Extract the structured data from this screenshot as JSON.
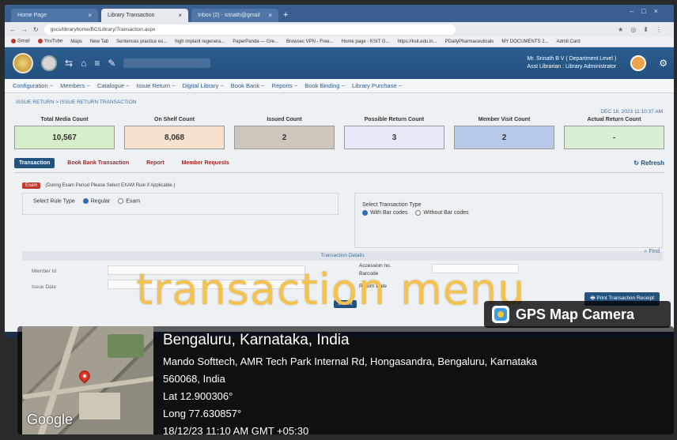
{
  "browser": {
    "tabs": [
      {
        "label": "Home Page",
        "active": false
      },
      {
        "label": "Library Transaction",
        "active": true
      },
      {
        "label": "Inbox (2) - srinath@gmail",
        "active": false
      }
    ],
    "url": "gscs/libraryhome/BC/Library/Transaction.aspx",
    "bookmarks": [
      "Gmail",
      "YouTube",
      "Maps",
      "New Tab",
      "Sentences practice ex...",
      "high implant regenera...",
      "PaperPanda — Gre...",
      "Browsec VPN - Free...",
      "Home page - KSIT G...",
      "https://ksit.edu.in...",
      "PDailyPharmaceuticals",
      "MY DOCUMENTS 2...",
      "Admit Card"
    ]
  },
  "app": {
    "user_name": "Mr. Srinath B V ( Department Level )",
    "user_role": "Asst Librarian : Library Administrator",
    "menu": [
      "Configuration ~",
      "Members ~",
      "Catalogue ~",
      "Issue Return ~",
      "Digital Library ~",
      "Book Bank ~",
      "Reports ~",
      "Book Binding ~",
      "Library Purchase ~"
    ]
  },
  "page": {
    "breadcrumb": "ISSUE RETURN > ISSUE RETURN TRANSACTION",
    "datetime": "DEC 18, 2023 11:10:37 AM",
    "stats": [
      {
        "label": "Total Media Count",
        "value": "10,567",
        "color": "#d7efc9"
      },
      {
        "label": "On Shelf Count",
        "value": "8,068",
        "color": "#f6e2cf"
      },
      {
        "label": "Issued Count",
        "value": "2",
        "color": "#cfc7bd"
      },
      {
        "label": "Possible Return Count",
        "value": "3",
        "color": "#e6e9f8"
      },
      {
        "label": "Member Visit Count",
        "value": "2",
        "color": "#b7c8e8"
      },
      {
        "label": "Actual Return Count",
        "value": "-",
        "color": "#d9efd4"
      }
    ],
    "subtabs": [
      "Transaction",
      "Book Bank Transaction",
      "Report",
      "Member Requests"
    ],
    "refresh": "Refresh",
    "note_badge": "Exam",
    "note": "(During Exam Period Please Select EXAM Rule if Applicable.)",
    "rule_label": "Select Rule Type",
    "rule_options": [
      "Regular",
      "Exam"
    ],
    "txn_type_label": "Select Transaction Type",
    "txn_options": [
      "With Bar codes",
      "Without Bar codes"
    ],
    "details_header": "Transaction Details",
    "find": "Find",
    "member_id_label": "Member Id",
    "issue_date_label": "Issue Date",
    "accession_label": "Accession no.",
    "barcode_label": "Barcode",
    "return_date_label": "Return Date",
    "submit": "Submit",
    "print": "Print Transaction Receipt"
  },
  "overlay": {
    "caption": "transaction menu",
    "badge": "GPS Map Camera"
  },
  "gps": {
    "city": "Bengaluru, Karnataka, India",
    "address1": "Mando Softtech, AMR Tech Park Internal Rd, Hongasandra, Bengaluru, Karnataka",
    "address2": "560068, India",
    "lat": "Lat 12.900306°",
    "long": "Long 77.630857°",
    "timestamp": "18/12/23 11:10 AM GMT +05:30",
    "map_brand": "Google"
  }
}
